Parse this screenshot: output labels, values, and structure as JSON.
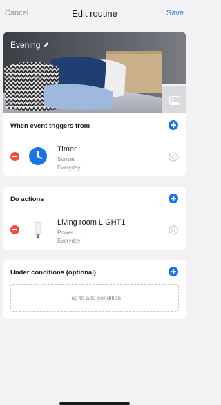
{
  "nav": {
    "cancel_label": "Cancel",
    "title": "Edit routine",
    "save_label": "Save"
  },
  "hero": {
    "title": "Evening"
  },
  "trigger_section": {
    "header": "When event triggers from",
    "item": {
      "name": "Timer",
      "detail": "Sunset",
      "schedule": "Everyday"
    }
  },
  "actions_section": {
    "header": "Do actions",
    "item": {
      "name": "Living room LIGHT1",
      "detail": "Power",
      "schedule": "Everyday"
    }
  },
  "conditions_section": {
    "header": "Under conditions (optional)",
    "placeholder": "Tap to add condition"
  },
  "colors": {
    "accent": "#1a73e8",
    "remove": "#ef4f43",
    "background": "#f2f2f4",
    "card": "#ffffff"
  },
  "icons": [
    "pencil-icon",
    "image-icon",
    "plus-icon",
    "minus-icon",
    "clock-icon",
    "bulb-icon",
    "gear-icon"
  ]
}
